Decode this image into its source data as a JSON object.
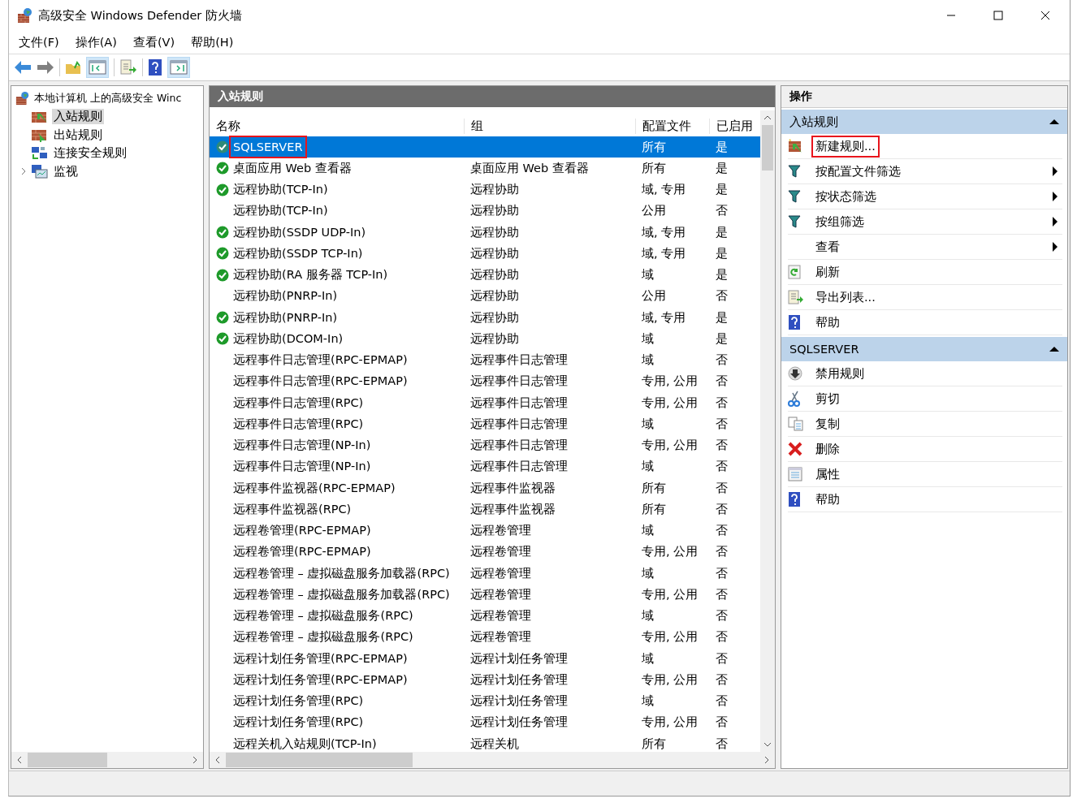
{
  "window": {
    "title": "高级安全 Windows Defender 防火墙"
  },
  "menu": [
    "文件(F)",
    "操作(A)",
    "查看(V)",
    "帮助(H)"
  ],
  "tree": {
    "label": "本地计算机 上的高级安全 Winc",
    "children": [
      {
        "label": "入站规则",
        "selected": true
      },
      {
        "label": "出站规则",
        "selected": false
      },
      {
        "label": "连接安全规则",
        "selected": false
      },
      {
        "label": "监视",
        "selected": false,
        "expanded": false
      }
    ]
  },
  "rules": {
    "title": "入站规则",
    "columns": [
      "名称",
      "组",
      "配置文件",
      "已启用"
    ],
    "rows": [
      {
        "name": "SQLSERVER",
        "group": "",
        "profile": "所有",
        "enabled_text": "是",
        "enabled": true,
        "selected": true,
        "highlighted": true
      },
      {
        "name": "桌面应用 Web 查看器",
        "group": "桌面应用 Web 查看器",
        "profile": "所有",
        "enabled_text": "是",
        "enabled": true,
        "selected": false,
        "highlighted": false
      },
      {
        "name": "远程协助(TCP-In)",
        "group": "远程协助",
        "profile": "域, 专用",
        "enabled_text": "是",
        "enabled": true,
        "selected": false,
        "highlighted": false
      },
      {
        "name": "远程协助(TCP-In)",
        "group": "远程协助",
        "profile": "公用",
        "enabled_text": "否",
        "enabled": false,
        "selected": false,
        "highlighted": false
      },
      {
        "name": "远程协助(SSDP UDP-In)",
        "group": "远程协助",
        "profile": "域, 专用",
        "enabled_text": "是",
        "enabled": true,
        "selected": false,
        "highlighted": false
      },
      {
        "name": "远程协助(SSDP TCP-In)",
        "group": "远程协助",
        "profile": "域, 专用",
        "enabled_text": "是",
        "enabled": true,
        "selected": false,
        "highlighted": false
      },
      {
        "name": "远程协助(RA 服务器 TCP-In)",
        "group": "远程协助",
        "profile": "域",
        "enabled_text": "是",
        "enabled": true,
        "selected": false,
        "highlighted": false
      },
      {
        "name": "远程协助(PNRP-In)",
        "group": "远程协助",
        "profile": "公用",
        "enabled_text": "否",
        "enabled": false,
        "selected": false,
        "highlighted": false
      },
      {
        "name": "远程协助(PNRP-In)",
        "group": "远程协助",
        "profile": "域, 专用",
        "enabled_text": "是",
        "enabled": true,
        "selected": false,
        "highlighted": false
      },
      {
        "name": "远程协助(DCOM-In)",
        "group": "远程协助",
        "profile": "域",
        "enabled_text": "是",
        "enabled": true,
        "selected": false,
        "highlighted": false
      },
      {
        "name": "远程事件日志管理(RPC-EPMAP)",
        "group": "远程事件日志管理",
        "profile": "域",
        "enabled_text": "否",
        "enabled": false,
        "selected": false,
        "highlighted": false
      },
      {
        "name": "远程事件日志管理(RPC-EPMAP)",
        "group": "远程事件日志管理",
        "profile": "专用, 公用",
        "enabled_text": "否",
        "enabled": false,
        "selected": false,
        "highlighted": false
      },
      {
        "name": "远程事件日志管理(RPC)",
        "group": "远程事件日志管理",
        "profile": "专用, 公用",
        "enabled_text": "否",
        "enabled": false,
        "selected": false,
        "highlighted": false
      },
      {
        "name": "远程事件日志管理(RPC)",
        "group": "远程事件日志管理",
        "profile": "域",
        "enabled_text": "否",
        "enabled": false,
        "selected": false,
        "highlighted": false
      },
      {
        "name": "远程事件日志管理(NP-In)",
        "group": "远程事件日志管理",
        "profile": "专用, 公用",
        "enabled_text": "否",
        "enabled": false,
        "selected": false,
        "highlighted": false
      },
      {
        "name": "远程事件日志管理(NP-In)",
        "group": "远程事件日志管理",
        "profile": "域",
        "enabled_text": "否",
        "enabled": false,
        "selected": false,
        "highlighted": false
      },
      {
        "name": "远程事件监视器(RPC-EPMAP)",
        "group": "远程事件监视器",
        "profile": "所有",
        "enabled_text": "否",
        "enabled": false,
        "selected": false,
        "highlighted": false
      },
      {
        "name": "远程事件监视器(RPC)",
        "group": "远程事件监视器",
        "profile": "所有",
        "enabled_text": "否",
        "enabled": false,
        "selected": false,
        "highlighted": false
      },
      {
        "name": "远程卷管理(RPC-EPMAP)",
        "group": "远程卷管理",
        "profile": "域",
        "enabled_text": "否",
        "enabled": false,
        "selected": false,
        "highlighted": false
      },
      {
        "name": "远程卷管理(RPC-EPMAP)",
        "group": "远程卷管理",
        "profile": "专用, 公用",
        "enabled_text": "否",
        "enabled": false,
        "selected": false,
        "highlighted": false
      },
      {
        "name": "远程卷管理 – 虚拟磁盘服务加载器(RPC)",
        "group": "远程卷管理",
        "profile": "域",
        "enabled_text": "否",
        "enabled": false,
        "selected": false,
        "highlighted": false
      },
      {
        "name": "远程卷管理 – 虚拟磁盘服务加载器(RPC)",
        "group": "远程卷管理",
        "profile": "专用, 公用",
        "enabled_text": "否",
        "enabled": false,
        "selected": false,
        "highlighted": false
      },
      {
        "name": "远程卷管理 – 虚拟磁盘服务(RPC)",
        "group": "远程卷管理",
        "profile": "域",
        "enabled_text": "否",
        "enabled": false,
        "selected": false,
        "highlighted": false
      },
      {
        "name": "远程卷管理 – 虚拟磁盘服务(RPC)",
        "group": "远程卷管理",
        "profile": "专用, 公用",
        "enabled_text": "否",
        "enabled": false,
        "selected": false,
        "highlighted": false
      },
      {
        "name": "远程计划任务管理(RPC-EPMAP)",
        "group": "远程计划任务管理",
        "profile": "域",
        "enabled_text": "否",
        "enabled": false,
        "selected": false,
        "highlighted": false
      },
      {
        "name": "远程计划任务管理(RPC-EPMAP)",
        "group": "远程计划任务管理",
        "profile": "专用, 公用",
        "enabled_text": "否",
        "enabled": false,
        "selected": false,
        "highlighted": false
      },
      {
        "name": "远程计划任务管理(RPC)",
        "group": "远程计划任务管理",
        "profile": "域",
        "enabled_text": "否",
        "enabled": false,
        "selected": false,
        "highlighted": false
      },
      {
        "name": "远程计划任务管理(RPC)",
        "group": "远程计划任务管理",
        "profile": "专用, 公用",
        "enabled_text": "否",
        "enabled": false,
        "selected": false,
        "highlighted": false
      },
      {
        "name": "远程关机入站规则(TCP-In)",
        "group": "远程关机",
        "profile": "所有",
        "enabled_text": "否",
        "enabled": false,
        "selected": false,
        "highlighted": false
      }
    ]
  },
  "actions": {
    "title": "操作",
    "sections": [
      {
        "title": "入站规则",
        "expanded": true,
        "items": [
          {
            "label": "新建规则...",
            "kind": "new-rule",
            "submenu": false,
            "highlighted": true
          },
          {
            "label": "按配置文件筛选",
            "kind": "filter",
            "submenu": true,
            "highlighted": false
          },
          {
            "label": "按状态筛选",
            "kind": "filter",
            "submenu": true,
            "highlighted": false
          },
          {
            "label": "按组筛选",
            "kind": "filter",
            "submenu": true,
            "highlighted": false
          },
          {
            "label": "查看",
            "kind": "plain",
            "submenu": true,
            "highlighted": false
          },
          {
            "label": "刷新",
            "kind": "refresh",
            "submenu": false,
            "highlighted": false
          },
          {
            "label": "导出列表...",
            "kind": "export",
            "submenu": false,
            "highlighted": false
          },
          {
            "label": "帮助",
            "kind": "help",
            "submenu": false,
            "highlighted": false
          }
        ]
      },
      {
        "title": "SQLSERVER",
        "expanded": true,
        "items": [
          {
            "label": "禁用规则",
            "kind": "disable",
            "submenu": false,
            "highlighted": false
          },
          {
            "label": "剪切",
            "kind": "cut",
            "submenu": false,
            "highlighted": false
          },
          {
            "label": "复制",
            "kind": "copy",
            "submenu": false,
            "highlighted": false
          },
          {
            "label": "删除",
            "kind": "delete",
            "submenu": false,
            "highlighted": false
          },
          {
            "label": "属性",
            "kind": "properties",
            "submenu": false,
            "highlighted": false
          },
          {
            "label": "帮助",
            "kind": "help",
            "submenu": false,
            "highlighted": false
          }
        ]
      }
    ]
  }
}
